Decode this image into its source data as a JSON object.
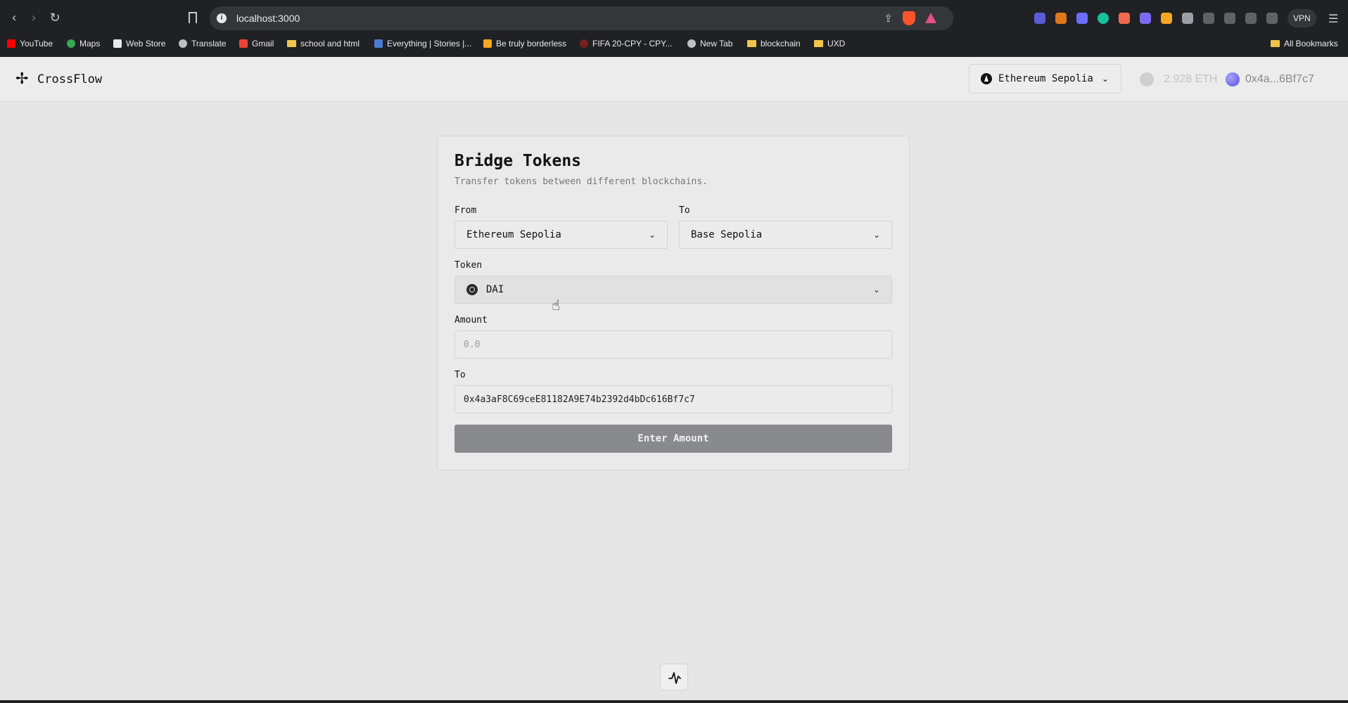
{
  "browser": {
    "url": "localhost:3000",
    "vpn_label": "VPN",
    "bookmarks": [
      {
        "label": "YouTube",
        "icon": "youtube-icon"
      },
      {
        "label": "Maps",
        "icon": "maps-icon"
      },
      {
        "label": "Web Store",
        "icon": "web-store-icon"
      },
      {
        "label": "Translate",
        "icon": "translate-icon"
      },
      {
        "label": "Gmail",
        "icon": "gmail-icon"
      },
      {
        "label": "school and html",
        "icon": "folder-icon"
      },
      {
        "label": "Everything | Stories |...",
        "icon": "site-icon"
      },
      {
        "label": "Be truly borderless",
        "icon": "site-icon"
      },
      {
        "label": "FIFA 20-CPY - CPY...",
        "icon": "site-icon"
      },
      {
        "label": "New Tab",
        "icon": "globe-icon"
      },
      {
        "label": "blockchain",
        "icon": "folder-icon"
      },
      {
        "label": "UXD",
        "icon": "folder-icon"
      }
    ],
    "all_bookmarks": "All Bookmarks"
  },
  "header": {
    "logo_text": "CrossFlow",
    "network": "Ethereum Sepolia",
    "balance": "2.928 ETH",
    "address": "0x4a...6Bf7c7"
  },
  "bridge": {
    "title": "Bridge Tokens",
    "subtitle": "Transfer tokens between different blockchains.",
    "from_label": "From",
    "from_value": "Ethereum Sepolia",
    "to_label": "To",
    "to_value": "Base Sepolia",
    "token_label": "Token",
    "token_value": "DAI",
    "amount_label": "Amount",
    "amount_placeholder": "0.0",
    "recipient_label": "To",
    "recipient_value": "0x4a3aF8C69ceE81182A9E74b2392d4bDc616Bf7c7",
    "submit_label": "Enter Amount"
  },
  "colors": {
    "background": "#e6e6e6",
    "button_disabled": "#898a8e",
    "brave": "#fb542b"
  }
}
